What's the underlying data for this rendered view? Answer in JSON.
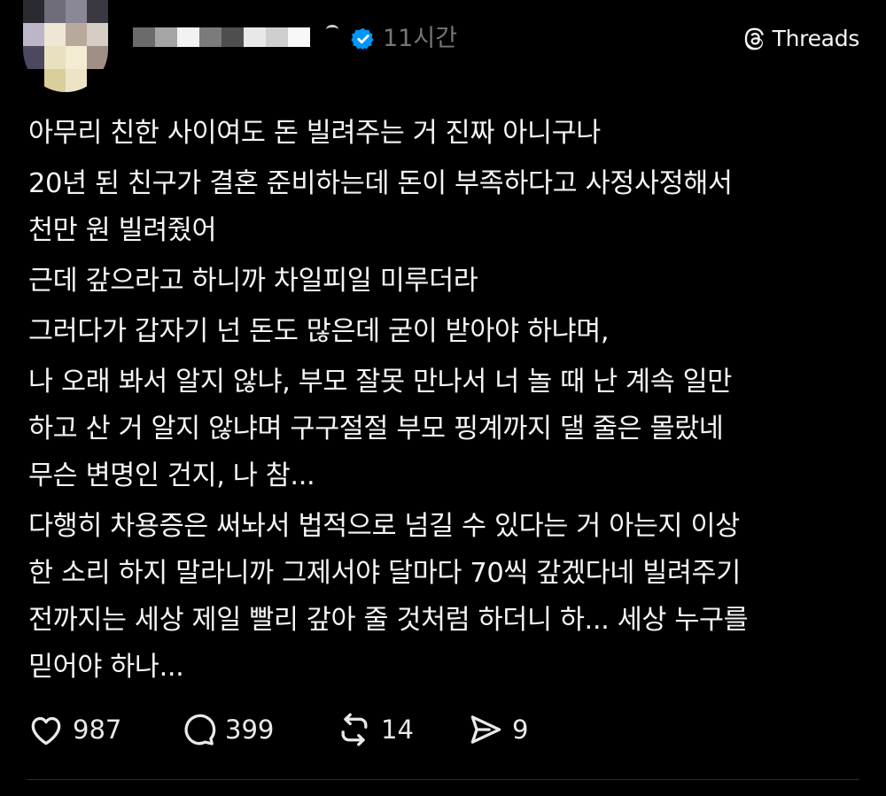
{
  "post": {
    "time": "11시간",
    "brand": "Threads",
    "paragraphs": [
      [
        "아무리 친한 사이여도 돈 빌려주는 거 진짜 아니구나"
      ],
      [
        "20년 된 친구가 결혼 준비하는데 돈이 부족하다고 사정사정해서",
        "천만 원 빌려줬어"
      ],
      [
        "근데 갚으라고 하니까 차일피일 미루더라"
      ],
      [
        "그러다가 갑자기 넌 돈도 많은데 굳이 받아야 하냐며,"
      ],
      [
        "나 오래 봐서 알지 않냐, 부모 잘못 만나서 너 놀 때 난 계속 일만",
        "하고 산 거 알지 않냐며 구구절절 부모 핑계까지 댈 줄은 몰랐네",
        "무슨 변명인 건지, 나 참..."
      ],
      [
        "다행히 차용증은 써놔서 법적으로 넘길 수 있다는 거 아는지 이상",
        "한 소리 하지 말라니까 그제서야 달마다 70씩 갚겠다네 빌려주기",
        "전까지는 세상 제일 빨리 갚아 줄 것처럼 하더니 하... 세상 누구를",
        "믿어야 하나..."
      ]
    ]
  },
  "actions": {
    "like_count": "987",
    "comment_count": "399",
    "repost_count": "14",
    "share_count": "9"
  },
  "icons": {
    "like": "heart-icon",
    "comment": "comment-bubble-icon",
    "repost": "repost-icon",
    "share": "share-send-icon",
    "verified": "verified-badge-icon",
    "brand": "threads-logo-icon"
  },
  "colors": {
    "background": "#000000",
    "text": "#f3f5f7",
    "muted": "#77777a",
    "verified": "#0095f6"
  }
}
